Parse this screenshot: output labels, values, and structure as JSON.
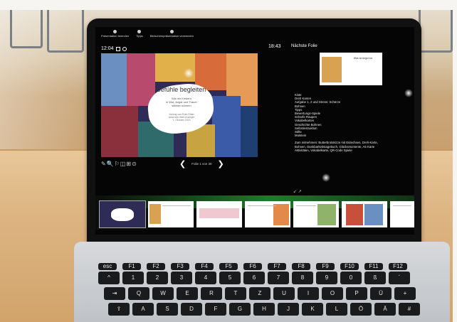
{
  "toolbar": {
    "items": [
      "Präsentation beenden",
      "Tipps",
      "Bildschirmpräsentation verwenden"
    ]
  },
  "presenter": {
    "elapsed": "12:04",
    "clock": "18:43",
    "next_slide_header": "Nächste Folie",
    "next_slide_title": "Was ist Angst los",
    "page_label": "Folie 1 von 30",
    "tools": "✎🔍⚐◫⊞⊙"
  },
  "slide": {
    "title": "Gefühle begleiten",
    "subtitle_lines": [
      "Wie wir Kindern",
      "in Wut, Angst und Trauer",
      "stärken können"
    ],
    "lecture": "Vortrag von Ruth Ritter",
    "lecture_extra": [
      "www.ruth-ritter.example",
      "1. Oktober 2023"
    ]
  },
  "notes": {
    "lines": [
      "Kiste",
      "Dreh Karten",
      "Aufgabe 1, 2 und Stress: Schürze",
      "Bohnen",
      "Tipps",
      "Bewertungs-Spiele",
      "Scharfe Raupen",
      "Vokabelkarten",
      "Geschichte Bohnen",
      "Selbstinstruktion",
      "Stifte",
      "Mutstein"
    ],
    "footer_lines": [
      "Zum mitnehmen: Butterbrotskizze mit Eidechsen, Dreh-Karte,",
      "Bohnen, Dankbarkeitstagebuch, Glücksmomente, A5 Karte",
      "Aktivitäten, Vokabelkarte, QR-Code Spiele"
    ]
  },
  "keyboard": {
    "row1": [
      "esc",
      "F1",
      "F2",
      "F3",
      "F4",
      "F5",
      "F6",
      "F7",
      "F8",
      "F9",
      "F10",
      "F11",
      "F12"
    ],
    "row2": [
      "^",
      "1",
      "2",
      "3",
      "4",
      "5",
      "6",
      "7",
      "8",
      "9",
      "0",
      "ß",
      "´"
    ],
    "row3": [
      "⇥",
      "Q",
      "W",
      "E",
      "R",
      "T",
      "Z",
      "U",
      "I",
      "O",
      "P",
      "Ü",
      "+"
    ],
    "row4": [
      "⇪",
      "A",
      "S",
      "D",
      "F",
      "G",
      "H",
      "J",
      "K",
      "L",
      "Ö",
      "Ä",
      "#"
    ]
  },
  "colors": {
    "wood": "#d2a46c",
    "screen_bg": "#050505",
    "slide_bg": "#2e2b57",
    "glow_green": "#28c83c"
  }
}
